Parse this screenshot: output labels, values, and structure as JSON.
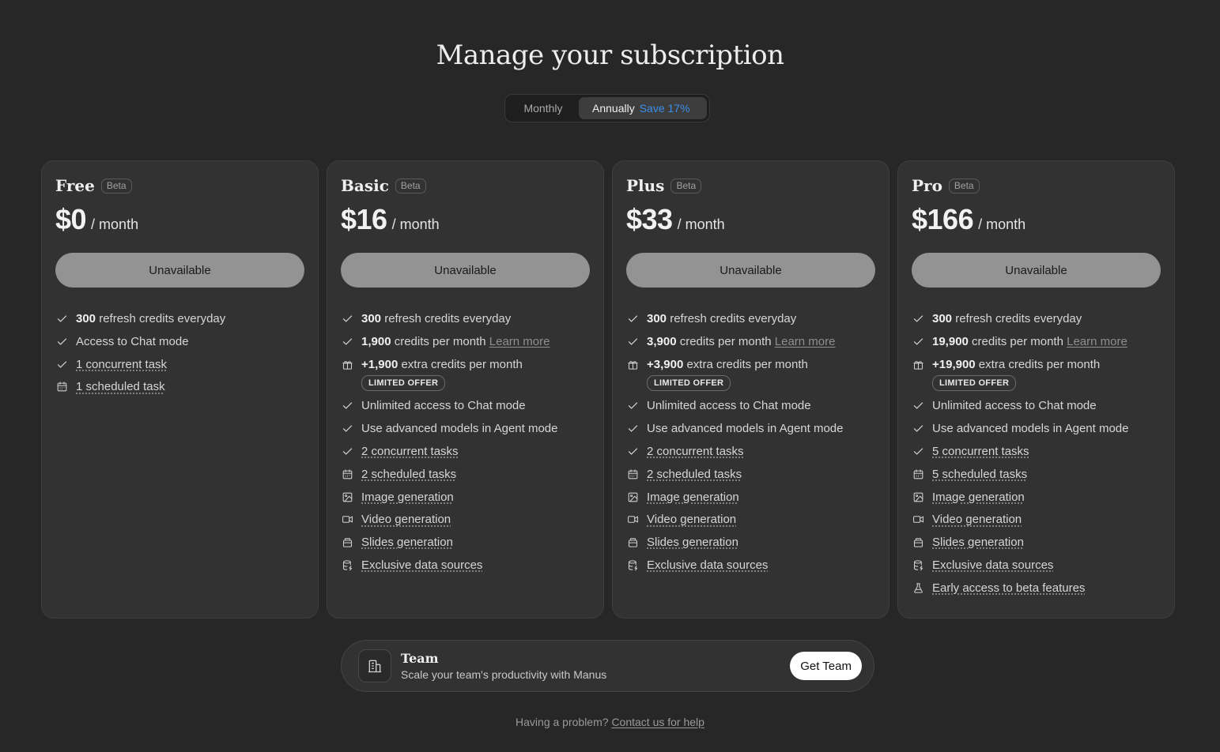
{
  "page": {
    "title": "Manage your subscription"
  },
  "billing_toggle": {
    "monthly_label": "Monthly",
    "annually_label": "Annually",
    "save_label": "Save 17%",
    "selected": "Annually"
  },
  "colors": {
    "background": "#272727",
    "card": "#323232",
    "accent_save": "#3b8eea",
    "button_disabled": "#939393"
  },
  "plans": [
    {
      "name": "Free",
      "badge": "Beta",
      "price": "$0",
      "period": "/ month",
      "button_label": "Unavailable",
      "features": [
        {
          "icon": "check-icon",
          "strong": "300",
          "text": " refresh credits everyday",
          "dotted": false
        },
        {
          "icon": "check-icon",
          "strong": "",
          "text": "Access to Chat mode",
          "dotted": false
        },
        {
          "icon": "check-icon",
          "strong": "",
          "text": "1 concurrent task",
          "dotted": true
        },
        {
          "icon": "calendar-icon",
          "strong": "",
          "text": "1 scheduled task",
          "dotted": true
        }
      ]
    },
    {
      "name": "Basic",
      "badge": "Beta",
      "price": "$16",
      "period": "/ month",
      "button_label": "Unavailable",
      "features": [
        {
          "icon": "check-icon",
          "strong": "300",
          "text": " refresh credits everyday",
          "dotted": false
        },
        {
          "icon": "check-icon",
          "strong": "1,900",
          "text": " credits per month ",
          "link": "Learn more",
          "dotted": false
        },
        {
          "icon": "gift-icon",
          "strong": "+1,900",
          "text": " extra credits per month",
          "badge": "LIMITED OFFER",
          "dotted": false
        },
        {
          "icon": "check-icon",
          "strong": "",
          "text": "Unlimited access to Chat mode",
          "dotted": false
        },
        {
          "icon": "check-icon",
          "strong": "",
          "text": "Use advanced models in Agent mode",
          "dotted": false
        },
        {
          "icon": "check-icon",
          "strong": "",
          "text": "2 concurrent tasks",
          "dotted": true
        },
        {
          "icon": "calendar-icon",
          "strong": "",
          "text": "2 scheduled tasks",
          "dotted": true
        },
        {
          "icon": "image-icon",
          "strong": "",
          "text": "Image generation",
          "dotted": true
        },
        {
          "icon": "video-icon",
          "strong": "",
          "text": "Video generation",
          "dotted": true
        },
        {
          "icon": "slides-icon",
          "strong": "",
          "text": "Slides generation",
          "dotted": true
        },
        {
          "icon": "database-icon",
          "strong": "",
          "text": "Exclusive data sources",
          "dotted": true
        }
      ]
    },
    {
      "name": "Plus",
      "badge": "Beta",
      "price": "$33",
      "period": "/ month",
      "button_label": "Unavailable",
      "features": [
        {
          "icon": "check-icon",
          "strong": "300",
          "text": " refresh credits everyday",
          "dotted": false
        },
        {
          "icon": "check-icon",
          "strong": "3,900",
          "text": " credits per month ",
          "link": "Learn more",
          "dotted": false
        },
        {
          "icon": "gift-icon",
          "strong": "+3,900",
          "text": " extra credits per month",
          "badge": "LIMITED OFFER",
          "dotted": false
        },
        {
          "icon": "check-icon",
          "strong": "",
          "text": "Unlimited access to Chat mode",
          "dotted": false
        },
        {
          "icon": "check-icon",
          "strong": "",
          "text": "Use advanced models in Agent mode",
          "dotted": false
        },
        {
          "icon": "check-icon",
          "strong": "",
          "text": "2 concurrent tasks",
          "dotted": true
        },
        {
          "icon": "calendar-icon",
          "strong": "",
          "text": "2 scheduled tasks",
          "dotted": true
        },
        {
          "icon": "image-icon",
          "strong": "",
          "text": "Image generation",
          "dotted": true
        },
        {
          "icon": "video-icon",
          "strong": "",
          "text": "Video generation",
          "dotted": true
        },
        {
          "icon": "slides-icon",
          "strong": "",
          "text": "Slides generation",
          "dotted": true
        },
        {
          "icon": "database-icon",
          "strong": "",
          "text": "Exclusive data sources",
          "dotted": true
        }
      ]
    },
    {
      "name": "Pro",
      "badge": "Beta",
      "price": "$166",
      "period": "/ month",
      "button_label": "Unavailable",
      "features": [
        {
          "icon": "check-icon",
          "strong": "300",
          "text": " refresh credits everyday",
          "dotted": false
        },
        {
          "icon": "check-icon",
          "strong": "19,900",
          "text": " credits per month ",
          "link": "Learn more",
          "dotted": false
        },
        {
          "icon": "gift-icon",
          "strong": "+19,900",
          "text": " extra credits per month",
          "badge": "LIMITED OFFER",
          "dotted": false
        },
        {
          "icon": "check-icon",
          "strong": "",
          "text": "Unlimited access to Chat mode",
          "dotted": false
        },
        {
          "icon": "check-icon",
          "strong": "",
          "text": "Use advanced models in Agent mode",
          "dotted": false
        },
        {
          "icon": "check-icon",
          "strong": "",
          "text": "5 concurrent tasks",
          "dotted": true
        },
        {
          "icon": "calendar-icon",
          "strong": "",
          "text": "5 scheduled tasks",
          "dotted": true
        },
        {
          "icon": "image-icon",
          "strong": "",
          "text": "Image generation",
          "dotted": true
        },
        {
          "icon": "video-icon",
          "strong": "",
          "text": "Video generation",
          "dotted": true
        },
        {
          "icon": "slides-icon",
          "strong": "",
          "text": "Slides generation",
          "dotted": true
        },
        {
          "icon": "database-icon",
          "strong": "",
          "text": "Exclusive data sources",
          "dotted": true
        },
        {
          "icon": "flask-icon",
          "strong": "",
          "text": "Early access to beta features",
          "dotted": true
        }
      ]
    }
  ],
  "team": {
    "title": "Team",
    "description": "Scale your team's productivity with Manus",
    "button_label": "Get Team",
    "icon": "building-icon"
  },
  "footer": {
    "text": "Having a problem? ",
    "link": "Contact us for help"
  }
}
